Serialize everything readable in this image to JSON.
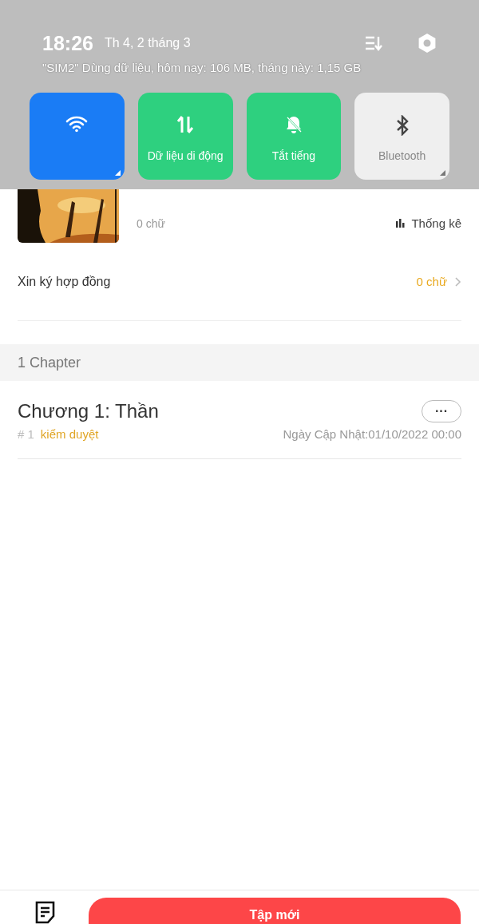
{
  "shade": {
    "time": "18:26",
    "date": "Th 4, 2 tháng 3",
    "usage": "\"SIM2\" Dùng dữ liệu, hôm nay: 106 MB, tháng này: 1,15 GB",
    "tiles": [
      {
        "kind": "wifi",
        "on": true,
        "color": "#1a7cf5"
      },
      {
        "kind": "data",
        "label": "Dữ liệu di động",
        "on": true,
        "color": "#2ed07f"
      },
      {
        "kind": "silent",
        "label": "Tắt tiếng",
        "on": true,
        "color": "#2ed07f"
      },
      {
        "kind": "bluetooth",
        "label": "Bluetooth",
        "on": false
      }
    ]
  },
  "book": {
    "words": "0 chữ",
    "stats": "Thống kê"
  },
  "contract": {
    "label": "Xin ký hợp đồng",
    "value": "0 chữ"
  },
  "section": {
    "title": "1 Chapter"
  },
  "chapters": [
    {
      "title": "Chương 1: Thần",
      "number": "# 1",
      "status": "kiểm duyệt",
      "updated": "Ngày Cập Nhật:01/10/2022 00:00",
      "more": "···"
    }
  ],
  "bottom": {
    "button": "Tập mới"
  }
}
